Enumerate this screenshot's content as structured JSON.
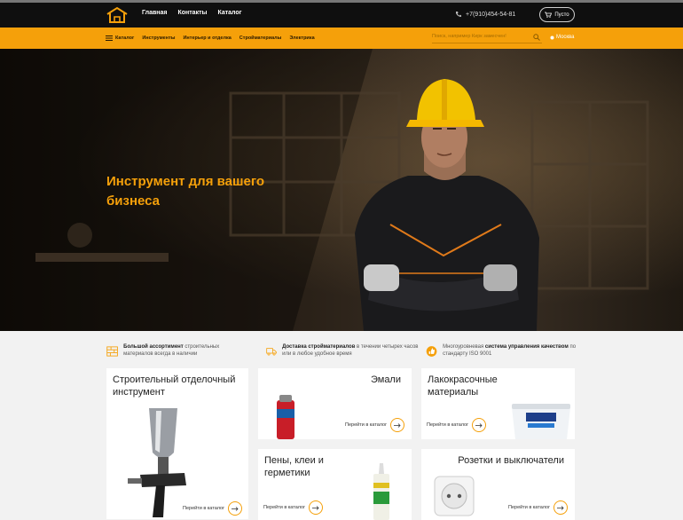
{
  "header": {
    "nav": [
      "Главная",
      "Контакты",
      "Каталог"
    ],
    "phone": "+7(910)454-54-81",
    "cart_label": "Пусто"
  },
  "catbar": {
    "catalog_label": "Каталог",
    "items": [
      "Инструменты",
      "Интерьер и отделка",
      "Стройматериалы",
      "Электрика"
    ],
    "search_placeholder": "Поиск, например Кирк замесчен!",
    "city": "Москва"
  },
  "hero": {
    "title": "Инструмент для вашего бизнеса"
  },
  "features": [
    {
      "bold": "Большой ассортимент",
      "text": " строительных материалов всегда в наличии",
      "icon": "bricks-icon"
    },
    {
      "bold": "Доставка стройматериалов",
      "text": " в течении четырех часов или в любое удобное время",
      "icon": "truck-icon"
    },
    {
      "pre": "Многоуровневая ",
      "bold": "система управления качеством",
      "text": " по стандарту ISO 9001",
      "icon": "quality-icon"
    }
  ],
  "cards": [
    {
      "title": "Строительный отделочный инструмент",
      "link": "Перейти в каталог"
    },
    {
      "title": "Эмали",
      "link": "Перейти в каталог"
    },
    {
      "title": "Лакокрасочные материалы",
      "link": "Перейти в каталог"
    },
    {
      "title": "Пены, клеи и герметики",
      "link": "Перейти в каталог"
    },
    {
      "title": "Розетки и выключатели",
      "link": "Перейти в каталог"
    }
  ],
  "colors": {
    "accent": "#f5a00a",
    "topbar": "#0f0f0f",
    "background": "#f2f2f2"
  }
}
